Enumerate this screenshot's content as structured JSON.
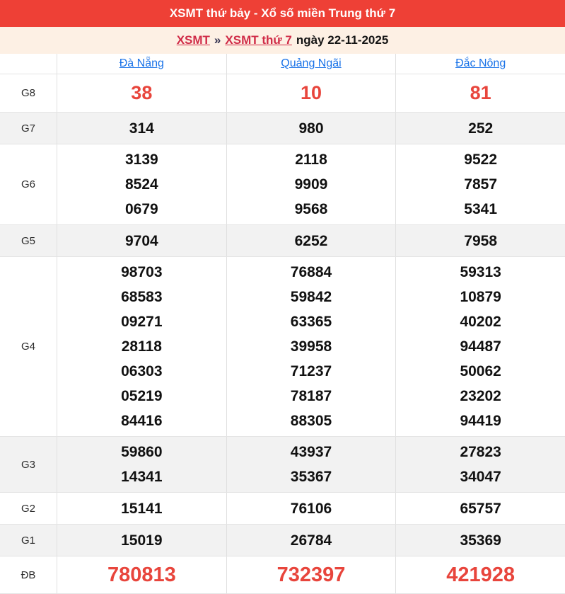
{
  "header": {
    "title": "XSMT thứ bảy - Xổ số miền Trung thứ 7"
  },
  "breadcrumb": {
    "link_xsmt": "XSMT",
    "separator": "»",
    "link_day": "XSMT thứ 7",
    "date_text": "ngày 22-11-2025"
  },
  "colors": {
    "topbar_red": "#ee4036",
    "breadcrumb_bg": "#fdf0e4",
    "breadcrumb_link_red": "#d02b47",
    "value_highlight_red": "#e8453c",
    "column_link_blue": "#1a73e8",
    "stripe_gray": "#f2f2f2",
    "border_gray": "#e0e0e0"
  },
  "table": {
    "columns": [
      "Đà Nẵng",
      "Quảng Ngãi",
      "Đắc Nông"
    ],
    "rows": [
      {
        "label": "G8",
        "values": [
          [
            "38"
          ],
          [
            "10"
          ],
          [
            "81"
          ]
        ]
      },
      {
        "label": "G7",
        "values": [
          [
            "314"
          ],
          [
            "980"
          ],
          [
            "252"
          ]
        ]
      },
      {
        "label": "G6",
        "values": [
          [
            "3139",
            "8524",
            "0679"
          ],
          [
            "2118",
            "9909",
            "9568"
          ],
          [
            "9522",
            "7857",
            "5341"
          ]
        ]
      },
      {
        "label": "G5",
        "values": [
          [
            "9704"
          ],
          [
            "6252"
          ],
          [
            "7958"
          ]
        ]
      },
      {
        "label": "G4",
        "values": [
          [
            "98703",
            "68583",
            "09271",
            "28118",
            "06303",
            "05219",
            "84416"
          ],
          [
            "76884",
            "59842",
            "63365",
            "39958",
            "71237",
            "78187",
            "88305"
          ],
          [
            "59313",
            "10879",
            "40202",
            "94487",
            "50062",
            "23202",
            "94419"
          ]
        ]
      },
      {
        "label": "G3",
        "values": [
          [
            "59860",
            "14341"
          ],
          [
            "43937",
            "35367"
          ],
          [
            "27823",
            "34047"
          ]
        ]
      },
      {
        "label": "G2",
        "values": [
          [
            "15141"
          ],
          [
            "76106"
          ],
          [
            "65757"
          ]
        ]
      },
      {
        "label": "G1",
        "values": [
          [
            "15019"
          ],
          [
            "26784"
          ],
          [
            "35369"
          ]
        ]
      },
      {
        "label": "ĐB",
        "values": [
          [
            "780813"
          ],
          [
            "732397"
          ],
          [
            "421928"
          ]
        ]
      }
    ]
  }
}
